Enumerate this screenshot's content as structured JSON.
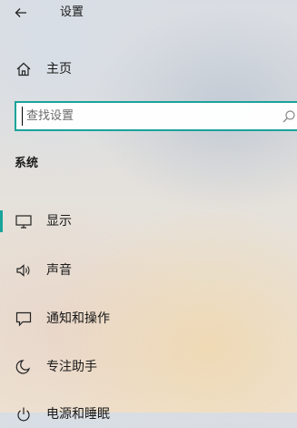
{
  "header": {
    "back_icon": "back-arrow-icon",
    "title": "设置"
  },
  "home": {
    "icon": "home-icon",
    "label": "主页"
  },
  "search": {
    "placeholder": "查找设置",
    "icon": "search-icon"
  },
  "section": {
    "title": "系统"
  },
  "nav": {
    "selected_index": 0,
    "accent_color": "#1aa39a",
    "items": [
      {
        "label": "显示",
        "icon": "monitor-icon"
      },
      {
        "label": "声音",
        "icon": "speaker-icon"
      },
      {
        "label": "通知和操作",
        "icon": "notification-icon"
      },
      {
        "label": "专注助手",
        "icon": "moon-icon"
      },
      {
        "label": "电源和睡眠",
        "icon": "power-icon"
      }
    ]
  }
}
